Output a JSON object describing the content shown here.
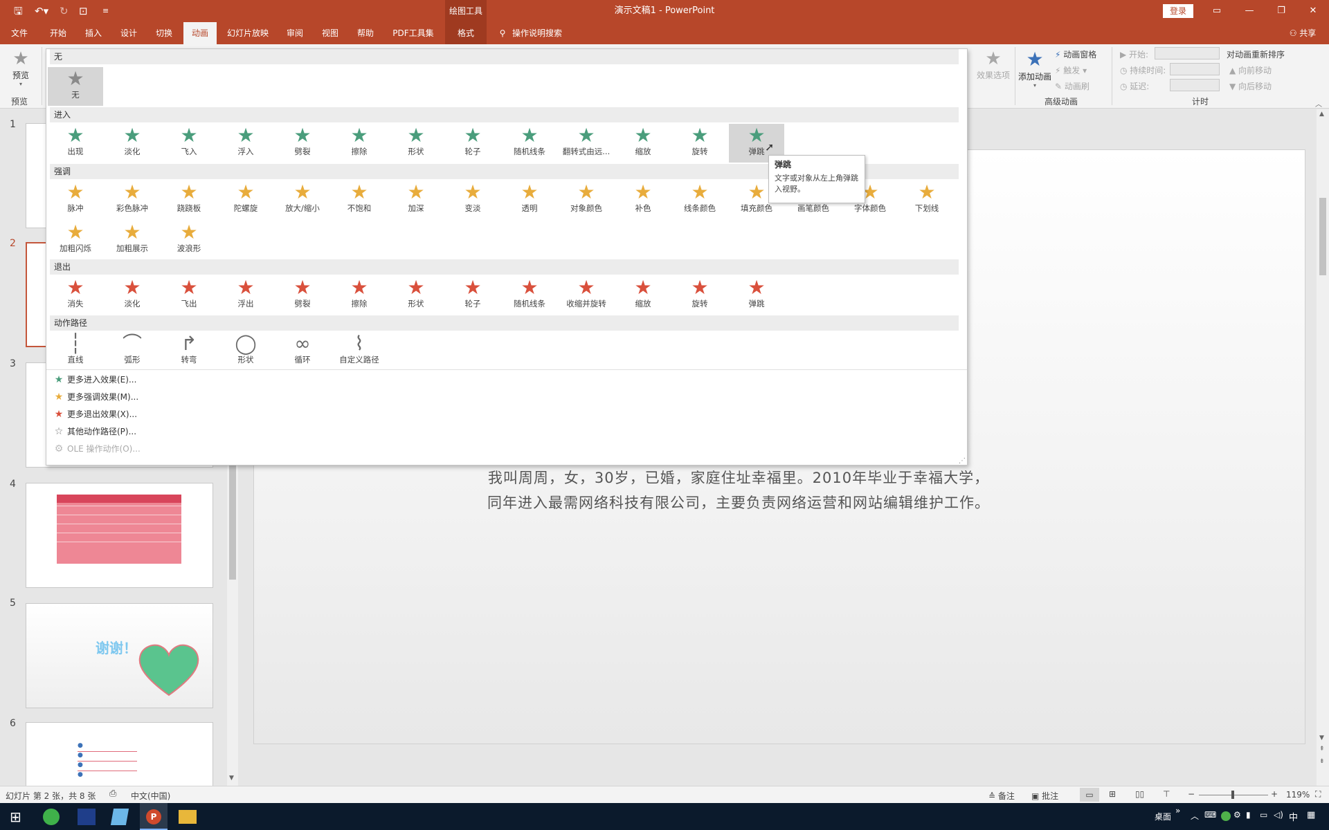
{
  "titlebar": {
    "title": "演示文稿1 - PowerPoint",
    "context": "绘图工具",
    "login": "登录"
  },
  "tabs": [
    "文件",
    "开始",
    "插入",
    "设计",
    "切换",
    "动画",
    "幻灯片放映",
    "审阅",
    "视图",
    "帮助",
    "PDF工具集",
    "格式"
  ],
  "tell_me": "操作说明搜索",
  "share": "共享",
  "ribbon": {
    "preview_label": "预览",
    "preview_group": "预览",
    "effect_options": "效果选项",
    "add_animation": "添加动画",
    "animation_pane": "动画窗格",
    "trigger": "触发",
    "anim_painter": "动画刷",
    "advanced_group": "高级动画",
    "start": "开始:",
    "duration": "持续时间:",
    "delay": "延迟:",
    "timing_group": "计时",
    "reorder": "对动画重新排序",
    "move_earlier": "向前移动",
    "move_later": "向后移动"
  },
  "gallery": {
    "sections": {
      "none": "无",
      "entrance": "进入",
      "emphasis": "强调",
      "exit": "退出",
      "paths": "动作路径"
    },
    "none_item": "无",
    "entrance": [
      "出现",
      "淡化",
      "飞入",
      "浮入",
      "劈裂",
      "擦除",
      "形状",
      "轮子",
      "随机线条",
      "翻转式由远...",
      "缩放",
      "旋转",
      "弹跳"
    ],
    "emphasis": [
      "脉冲",
      "彩色脉冲",
      "跷跷板",
      "陀螺旋",
      "放大/缩小",
      "不饱和",
      "加深",
      "变淡",
      "透明",
      "对象颜色",
      "补色",
      "线条颜色",
      "填充颜色",
      "画笔颜色",
      "字体颜色",
      "下划线",
      "加粗闪烁",
      "加粗展示",
      "波浪形"
    ],
    "exit": [
      "消失",
      "淡化",
      "飞出",
      "浮出",
      "劈裂",
      "擦除",
      "形状",
      "轮子",
      "随机线条",
      "收缩并旋转",
      "缩放",
      "旋转",
      "弹跳"
    ],
    "paths": [
      "直线",
      "弧形",
      "转弯",
      "形状",
      "循环",
      "自定义路径"
    ],
    "more": [
      "更多进入效果(E)...",
      "更多强调效果(M)...",
      "更多退出效果(X)...",
      "其他动作路径(P)...",
      "OLE 操作动作(O)..."
    ]
  },
  "tooltip": {
    "title": "弹跳",
    "body": "文字或对象从左上角弹跳入视野。"
  },
  "slide": {
    "line1": "我叫周周，女，30岁，已婚，家庭住址幸福里。2010年毕业于幸福大学，",
    "line2": "同年进入最需网络科技有限公司，主要负责网络运营和网站编辑维护工作。"
  },
  "thumbnails": {
    "numbers": [
      "1",
      "2",
      "3",
      "4",
      "5",
      "6"
    ],
    "thanks": "谢谢！"
  },
  "status": {
    "slide": "幻灯片 第 2 张，共 8 张",
    "lang": "中文(中国)",
    "notes": "备注",
    "comments": "批注",
    "zoom": "119%"
  },
  "taskbar": {
    "desktop": "桌面",
    "ime": "中"
  }
}
